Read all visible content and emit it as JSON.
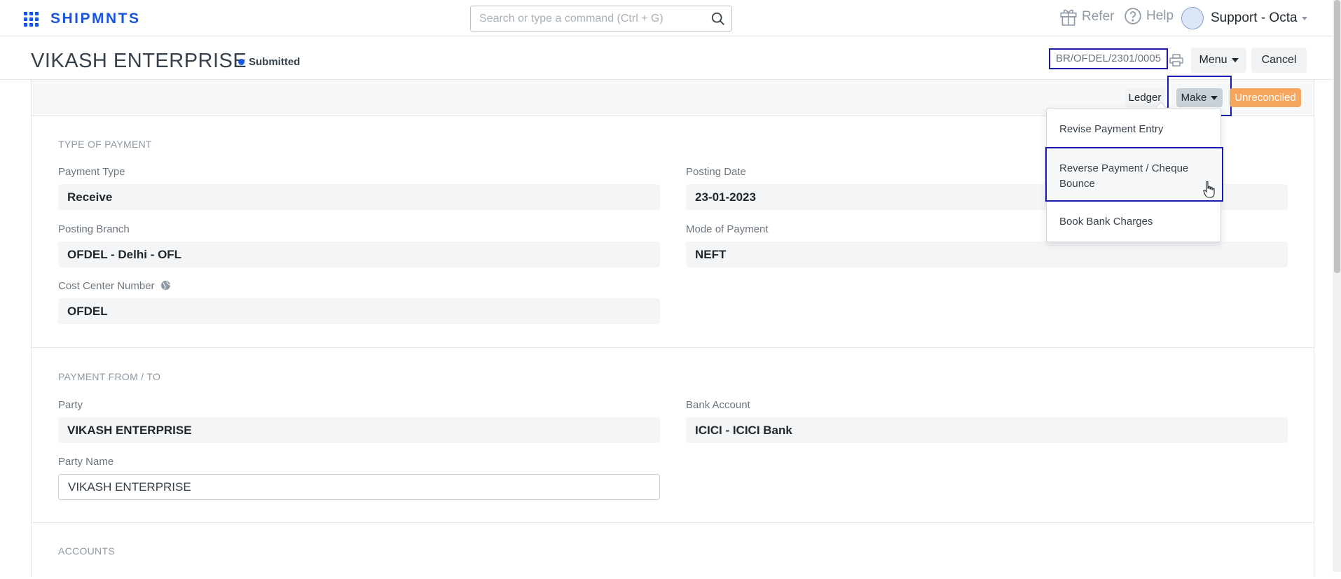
{
  "navbar": {
    "brand": "SHIPMNTS",
    "search_placeholder": "Search or type a command (Ctrl + G)",
    "refer_label": "Refer",
    "help_label": "Help",
    "user_label": "Support - Octa"
  },
  "header": {
    "title": "VIKASH ENTERPRISE",
    "status": "Submitted",
    "doc_id": "BR/OFDEL/2301/0005",
    "menu_label": "Menu",
    "cancel_label": "Cancel"
  },
  "toolbar": {
    "ledger_label": "Ledger",
    "make_label": "Make",
    "unreconciled_label": "Unreconciled",
    "unreconciled_color": "#f6a55c"
  },
  "make_menu": {
    "items": [
      "Revise Payment Entry",
      "Reverse Payment / Cheque Bounce",
      "Book Bank Charges"
    ]
  },
  "sections": {
    "type_of_payment": {
      "title": "TYPE OF PAYMENT",
      "payment_type_label": "Payment Type",
      "payment_type_value": "Receive",
      "posting_date_label": "Posting Date",
      "posting_date_value": "23-01-2023",
      "posting_branch_label": "Posting Branch",
      "posting_branch_value": "OFDEL - Delhi - OFL",
      "mode_of_payment_label": "Mode of Payment",
      "mode_of_payment_value": "NEFT",
      "cost_center_label": "Cost Center Number",
      "cost_center_value": "OFDEL"
    },
    "payment_from_to": {
      "title": "PAYMENT FROM / TO",
      "party_label": "Party",
      "party_value": "VIKASH ENTERPRISE",
      "bank_account_label": "Bank Account",
      "bank_account_value": "ICICI - ICICI Bank",
      "party_name_label": "Party Name",
      "party_name_value": "VIKASH ENTERPRISE"
    },
    "accounts": {
      "title": "ACCOUNTS"
    }
  },
  "colors": {
    "brand": "#1a56db",
    "highlight_border": "#1a1ab0"
  }
}
